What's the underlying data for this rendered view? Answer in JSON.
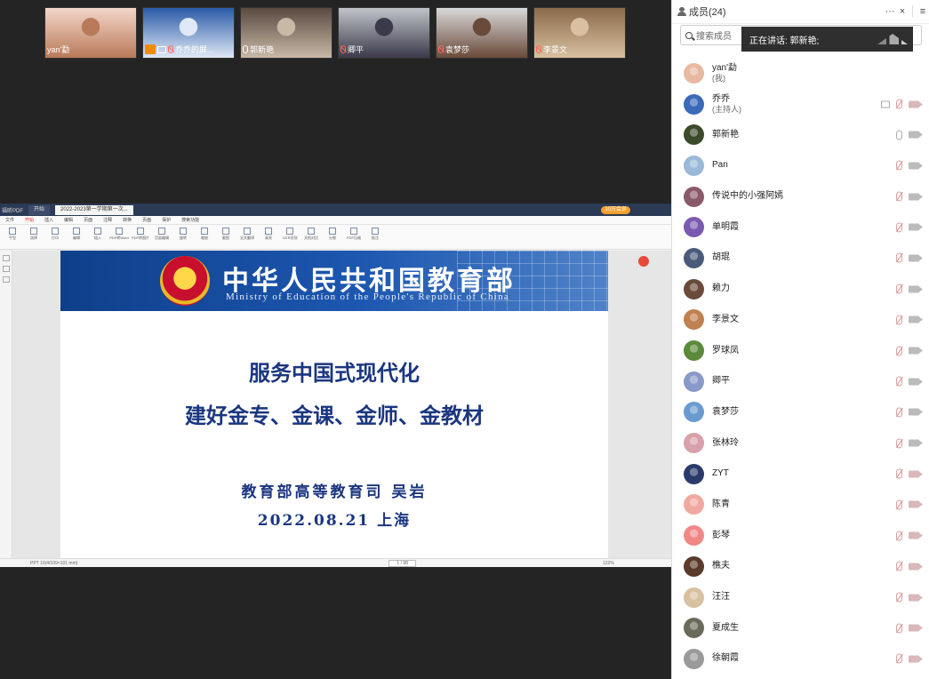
{
  "thumbnails": [
    {
      "name": "yan'勐",
      "mic": "none",
      "colors": [
        "#f3d6c8",
        "#b97a5a"
      ]
    },
    {
      "name": "乔乔的屏...",
      "mic": "off",
      "colors": [
        "#2a5aa8",
        "#dfe8f5"
      ],
      "share": true
    },
    {
      "name": "郭新艳",
      "mic": "on",
      "colors": [
        "#5a4a40",
        "#c8b8a8"
      ]
    },
    {
      "name": "卿平",
      "mic": "off",
      "colors": [
        "#c0c4c8",
        "#3a3a4a"
      ]
    },
    {
      "name": "袁梦莎",
      "mic": "off",
      "colors": [
        "#d8d8d8",
        "#6a4a3a"
      ]
    },
    {
      "name": "李景文",
      "mic": "off",
      "colors": [
        "#8a6a4a",
        "#d8c0a0"
      ]
    }
  ],
  "pdf": {
    "app_tab": "福昕PDF",
    "tabs": [
      "开始",
      "2022-2023第一学期第一次..."
    ],
    "vip": "10万会员",
    "menus": [
      "文件",
      "开始",
      "插入",
      "编辑",
      "页面",
      "注释",
      "转换",
      "页面",
      "保护",
      "搜索功能"
    ],
    "ribbon": [
      "手型",
      "选择",
      "打印",
      "编辑",
      "插入",
      "PDF转Word",
      "PDF转图片",
      "页面编辑",
      "旋转",
      "缩放",
      "截图",
      "全文翻译",
      "高亮",
      "OCR识别",
      "文档对比",
      "分割",
      "PDF压缩",
      "批注"
    ],
    "page_indicator": "1 / 98",
    "zoom": "122%",
    "status_left": "PPT 10(4/339×101 mm)",
    "slide": {
      "banner_cn": "中华人民共和国教育部",
      "banner_en": "Ministry of Education of the People's Republic of China",
      "title1": "服务中国式现代化",
      "title2": "建好金专、金课、金师、金教材",
      "author": "教育部高等教育司  吴岩",
      "date": "2022.08.21    上海"
    }
  },
  "panel": {
    "title": "成员(24)",
    "more": "···",
    "close": "×",
    "menu": "≡",
    "search_placeholder": "搜索成员",
    "speaking": "正在讲话: 郭新艳;"
  },
  "members": [
    {
      "name": "yan'勐",
      "role": "(我)",
      "color": "#e8b8a0",
      "mic": "none",
      "cam": "none"
    },
    {
      "name": "乔乔",
      "role": "(主持人)",
      "color": "#3a6ab8",
      "mic": "off",
      "cam": "off",
      "screen": true
    },
    {
      "name": "郭新艳",
      "role": "",
      "color": "#3a4a2a",
      "mic": "on",
      "cam": "on"
    },
    {
      "name": "Pan",
      "role": "",
      "color": "#9ab8d8",
      "mic": "off",
      "cam": "on"
    },
    {
      "name": "传说中的小强阿嫣",
      "role": "",
      "color": "#8a5a6a",
      "mic": "off",
      "cam": "on"
    },
    {
      "name": "单明霞",
      "role": "",
      "color": "#7a5ab0",
      "mic": "off",
      "cam": "on"
    },
    {
      "name": "胡琨",
      "role": "",
      "color": "#4a5a7a",
      "mic": "off",
      "cam": "on"
    },
    {
      "name": "赖力",
      "role": "",
      "color": "#6a4a3a",
      "mic": "off",
      "cam": "on"
    },
    {
      "name": "李景文",
      "role": "",
      "color": "#c08050",
      "mic": "off",
      "cam": "on"
    },
    {
      "name": "罗球凤",
      "role": "",
      "color": "#5a8a3a",
      "mic": "off",
      "cam": "on"
    },
    {
      "name": "卿平",
      "role": "",
      "color": "#8a9ac8",
      "mic": "off",
      "cam": "on"
    },
    {
      "name": "袁梦莎",
      "role": "",
      "color": "#6a9ad0",
      "mic": "off",
      "cam": "on"
    },
    {
      "name": "张林玲",
      "role": "",
      "color": "#d8a0a8",
      "mic": "off",
      "cam": "on"
    },
    {
      "name": "ZYT",
      "role": "",
      "color": "#2a3a6a",
      "mic": "off",
      "cam": "off"
    },
    {
      "name": "陈青",
      "role": "",
      "color": "#f0a8a0",
      "mic": "off",
      "cam": "off"
    },
    {
      "name": "彭琴",
      "role": "",
      "color": "#f08888",
      "mic": "off",
      "cam": "off"
    },
    {
      "name": "樵夫",
      "role": "",
      "color": "#5a3a2a",
      "mic": "off",
      "cam": "off"
    },
    {
      "name": "汪汪",
      "role": "",
      "color": "#d8c0a0",
      "mic": "off",
      "cam": "off"
    },
    {
      "name": "夏成生",
      "role": "",
      "color": "#6a6a5a",
      "mic": "off",
      "cam": "off"
    },
    {
      "name": "徐朝霞",
      "role": "",
      "color": "#9a9a9a",
      "mic": "off",
      "cam": "off"
    }
  ]
}
